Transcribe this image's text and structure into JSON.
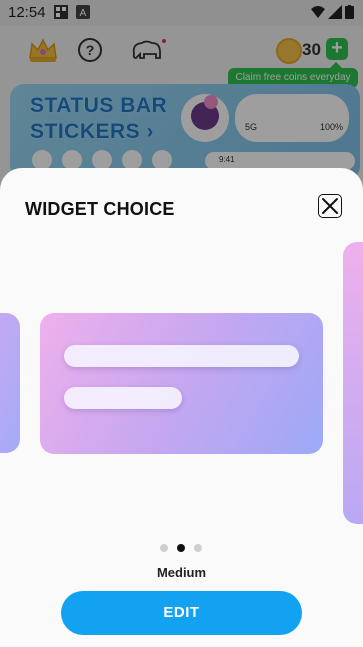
{
  "status_bar": {
    "time": "12:54",
    "icons": [
      "qr-icon",
      "a-icon",
      "wifi-icon",
      "signal-icon",
      "battery-icon"
    ]
  },
  "app": {
    "coins": "30",
    "claim_tip": "Claim free coins everyday",
    "help_symbol": "?",
    "plus_symbol": "+",
    "banner": {
      "title_line1": "STATUS BAR",
      "title_line2": "STICKERS",
      "chevron": "›",
      "phone_network": "5G",
      "phone_battery_pct": "100%",
      "phone_time": "9:41"
    }
  },
  "sheet": {
    "title": "WIDGET CHOICE",
    "page_count": 3,
    "active_page": 2,
    "size_label": "Medium",
    "edit_label": "EDIT"
  },
  "colors": {
    "accent": "#13a2f2",
    "coin_green": "#2ec24f",
    "card_gradient_start": "#eeb0ec",
    "card_gradient_end": "#9ca9f7"
  }
}
